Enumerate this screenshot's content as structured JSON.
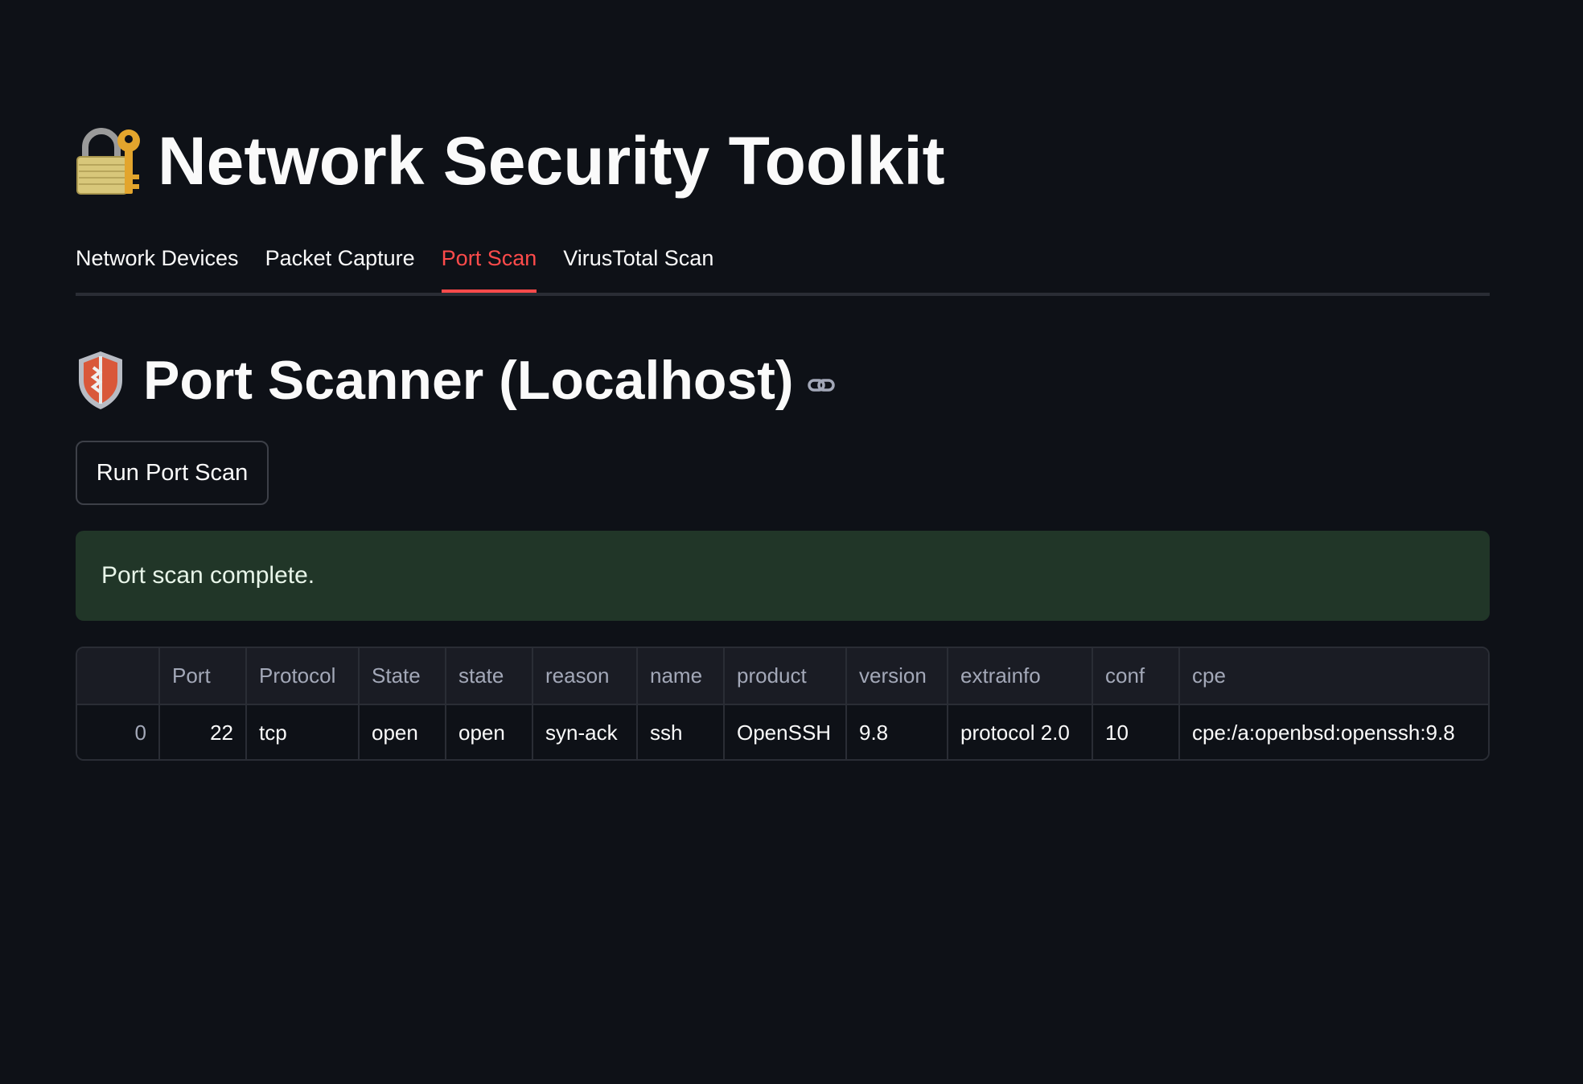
{
  "app": {
    "title": "Network Security Toolkit",
    "title_icon": "lock-with-key-icon"
  },
  "tabs": [
    {
      "label": "Network Devices",
      "active": false
    },
    {
      "label": "Packet Capture",
      "active": false
    },
    {
      "label": "Port Scan",
      "active": true
    },
    {
      "label": "VirusTotal Scan",
      "active": false
    }
  ],
  "section": {
    "title": "Port Scanner (Localhost)",
    "icon": "shield-icon",
    "anchor_icon": "link-icon"
  },
  "actions": {
    "run_label": "Run Port Scan"
  },
  "alert": {
    "message": "Port scan complete.",
    "color": "#213628"
  },
  "table": {
    "columns": [
      "",
      "Port",
      "Protocol",
      "State",
      "state",
      "reason",
      "name",
      "product",
      "version",
      "extrainfo",
      "conf",
      "cpe"
    ],
    "rows": [
      [
        "0",
        "22",
        "tcp",
        "open",
        "open",
        "syn-ack",
        "ssh",
        "OpenSSH",
        "9.8",
        "protocol 2.0",
        "10",
        "cpe:/a:openbsd:openssh:9.8"
      ]
    ]
  },
  "colors": {
    "background": "#0e1117",
    "accent": "#ff4b4b",
    "text": "#fafafa"
  }
}
